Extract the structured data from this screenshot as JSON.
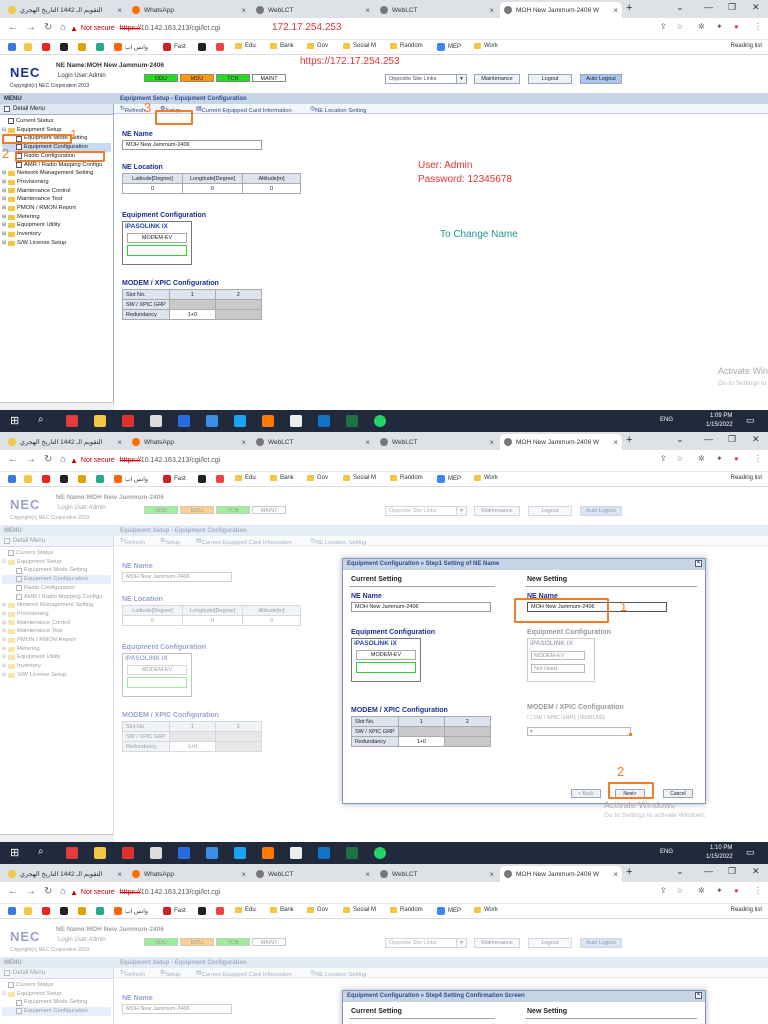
{
  "browser": {
    "tabs": [
      {
        "label": "التقويم الـ 1442 التاريخ الهجري",
        "icon": "if-icon",
        "color": "#f2c744"
      },
      {
        "label": "WhatsApp",
        "icon": "whatsapp-icon",
        "color": "#ff6a00"
      },
      {
        "label": "WebLCT",
        "icon": "globe-icon",
        "color": "#555555"
      },
      {
        "label": "WebLCT",
        "icon": "globe-icon",
        "color": "#555555"
      },
      {
        "label": "MOH New Jammum-2406 W",
        "icon": "globe-icon",
        "color": "#555555"
      }
    ],
    "not_secure": "Not secure",
    "url_scheme": "https://",
    "url_rest": "10.142.163.213/cgi/lct.cgi",
    "bookmarks": [
      "واتس اب",
      "Fast",
      "Edu",
      "Bank",
      "Gov",
      "Social M",
      "Random",
      "MEP",
      "Work"
    ],
    "reading_list": "Reading list"
  },
  "nec": {
    "logo": "NEC",
    "ne_name": "NE Name:MOH New Jammum-2406",
    "login_user": "Login User:Admin",
    "copyright": "Copyright(c) NEC Corporation 2013",
    "status": [
      {
        "label": "ODU",
        "color": "#22dd22"
      },
      {
        "label": "MDU",
        "color": "#ff9900"
      },
      {
        "label": "TCN",
        "color": "#22dd22"
      },
      {
        "label": "MAINT",
        "color": "#ffffff"
      }
    ],
    "site_select": "Opposite Site Links",
    "maintenance": "Maintenance",
    "logout": "Logout",
    "auto_logout": "Auto Logout"
  },
  "menu": {
    "title": "MENU",
    "detail_menu": "Detail Menu",
    "items": [
      "Current Status",
      "Equipment Setup",
      "Equipment Mode Setting",
      "Equipment Configuration",
      "Radio Configuration",
      "AMR / Radio Mapping Configu",
      "Network Management Setting",
      "Provisioning",
      "Maintenance Control",
      "Maintenance Test",
      "PMON / RMON Report",
      "Metering",
      "Equipment Utility",
      "Inventory",
      "S/W License Setup"
    ]
  },
  "page": {
    "heading": "Equipment Setup - Equipment Configuration",
    "toolbar": {
      "refresh": "Refresh",
      "setup": "Setup",
      "card_info": "Current Equipped Card Information",
      "location": "NE Location Setting"
    },
    "ne_name_label": "NE Name",
    "ne_name_value": "MOH New Jammum-2406",
    "ne_location_label": "NE Location",
    "location_headers": [
      "Latitude[Degree]",
      "Longitude[Degree]",
      "Altitude[m]"
    ],
    "location_values": [
      "0",
      "0",
      "0"
    ],
    "equip_config_label": "Equipment Configuration",
    "pasolink": "iPASOLINK iX",
    "modem": "MODEM-EV",
    "modem_xpic_label": "MODEM / XPIC Configuration",
    "slot_no": "Slot No.",
    "slot_1": "1",
    "slot_2": "2",
    "sw_xpic": "SW / XPIC GRP",
    "redundancy": "Redundancy",
    "redundancy_value": "1+0"
  },
  "annotations": {
    "ip": "172.17.254.253",
    "url": "https://172.17.254.253",
    "user": "User: Admin",
    "password": "Password: 12345678",
    "change_name": "To Change Name",
    "n1": "1",
    "n2": "2",
    "n3": "3"
  },
  "dialog": {
    "title_step1": "Equipment Configuration » Step1 Setting of NE Name",
    "title_step4": "Equipment Configuration » Step4 Setting Confirmation Screen",
    "current": "Current Setting",
    "new": "New Setting",
    "ne_name_new": "MOH New Jammum-2406",
    "not_used": "Not Used",
    "xpic_check": "SW / XPIC GRP1 (Slot01/02)",
    "back": "< Back",
    "next": "Next>",
    "cancel": "Cancel"
  },
  "activate": {
    "line1": "Activate Windows",
    "line2": "Go to Settings to activate Windows."
  },
  "taskbar": {
    "lang": "ENG",
    "time1": "1:09 PM",
    "time2": "1:10 PM",
    "date": "1/15/2022"
  }
}
